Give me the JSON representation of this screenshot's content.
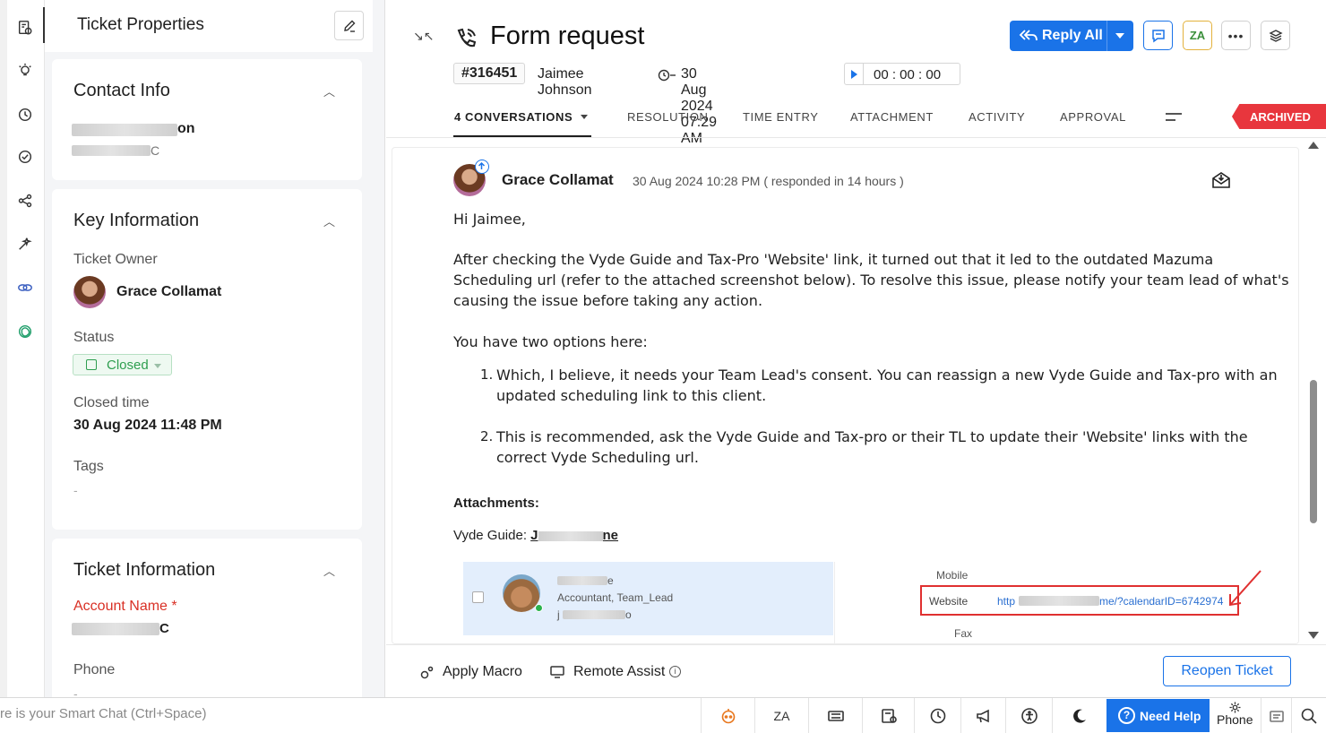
{
  "properties_panel": {
    "title": "Ticket Properties",
    "contact_info": {
      "title": "Contact Info",
      "name_suffix": "on",
      "company_suffix": "C"
    },
    "key_information": {
      "title": "Key Information",
      "ticket_owner_label": "Ticket Owner",
      "ticket_owner": "Grace Collamat",
      "status_label": "Status",
      "status_value": "Closed",
      "closed_time_label": "Closed time",
      "closed_time": "30 Aug 2024 11:48 PM",
      "tags_label": "Tags",
      "tags_value": "-"
    },
    "ticket_information": {
      "title": "Ticket Information",
      "account_name_label": "Account Name *",
      "account_name_suffix": "C",
      "phone_label": "Phone",
      "phone_value": "-"
    }
  },
  "ticket": {
    "title": "Form request",
    "id": "#316451",
    "contact": "Jaimee Johnson",
    "created": "30 Aug 2024 07:29 AM",
    "timer": "00 : 00 : 00",
    "reply_all_label": "Reply All",
    "status_ribbon": "ARCHIVED"
  },
  "tabs": [
    {
      "label": "4 CONVERSATIONS"
    },
    {
      "label": "RESOLUTION"
    },
    {
      "label": "TIME ENTRY"
    },
    {
      "label": "ATTACHMENT"
    },
    {
      "label": "ACTIVITY"
    },
    {
      "label": "APPROVAL"
    }
  ],
  "conversation": {
    "sender": "Grace Collamat",
    "time": "30 Aug 2024 10:28 PM",
    "responded": "( responded in 14 hours )",
    "greeting": "Hi Jaimee,",
    "para1_line1": "After checking the Vyde Guide and Tax-Pro 'Website' link, it turned out that it led to the outdated Mazuma",
    "para1_line2": "Scheduling url (refer to the attached screenshot below). To resolve this issue, please notify your team lead of what's",
    "para1_line3": "causing the issue before taking any action.",
    "para2": "You have two options here:",
    "item1_line1": "Which, I believe, it needs your Team Lead's consent. You can reassign a new Vyde Guide and Tax-pro with an",
    "item1_line2": "updated scheduling link to this client.",
    "item2_line1": "This is recommended, ask the Vyde Guide and Tax-pro or their TL to update their 'Website' links with the",
    "item2_line2": "correct Vyde Scheduling url.",
    "item1_num": "1.",
    "item2_num": "2.",
    "attachments_label": "Attachments:",
    "guide_label": "Vyde Guide:",
    "guide_name_start": "J",
    "guide_name_end": "ne",
    "screenshot": {
      "name_suffix": "e",
      "role": "Accountant, Team_Lead",
      "email_start": "j",
      "email_end": "o",
      "mobile_label": "Mobile",
      "website_label": "Website",
      "url_start": "http",
      "url_end": "me/?calendarID=6742974",
      "fax_label": "Fax"
    }
  },
  "actions": {
    "apply_macro": "Apply Macro",
    "remote_assist": "Remote Assist",
    "reopen": "Reopen Ticket"
  },
  "bottom_bar": {
    "smart_chat": "re is your Smart Chat (Ctrl+Space)",
    "need_help": "Need Help",
    "phone": "Phone"
  },
  "colors": {
    "accent": "#1a73e8",
    "archived": "#e8363d",
    "closed_status": "#2e9e4f",
    "required_label": "#d93025"
  }
}
